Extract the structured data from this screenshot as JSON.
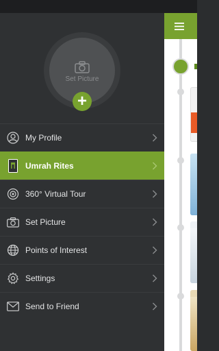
{
  "drawer": {
    "avatar_label": "Set Picture",
    "add_symbol": "+",
    "items": [
      {
        "label": "My Profile",
        "icon": "user-icon",
        "active": false
      },
      {
        "label": "Umrah Rites",
        "icon": "kaaba-icon",
        "active": true
      },
      {
        "label": "360° Virtual Tour",
        "icon": "360-tour-icon",
        "active": false
      },
      {
        "label": "Set Picture",
        "icon": "camera-icon",
        "active": false
      },
      {
        "label": "Points of Interest",
        "icon": "globe-icon",
        "active": false
      },
      {
        "label": "Settings",
        "icon": "gear-icon",
        "active": false
      },
      {
        "label": "Send to Friend",
        "icon": "envelope-icon",
        "active": false
      }
    ]
  },
  "colors": {
    "accent": "#78a22f",
    "drawer_bg": "#2f3133",
    "status_bar": "#1d1e20",
    "text": "#e3e4e5"
  }
}
